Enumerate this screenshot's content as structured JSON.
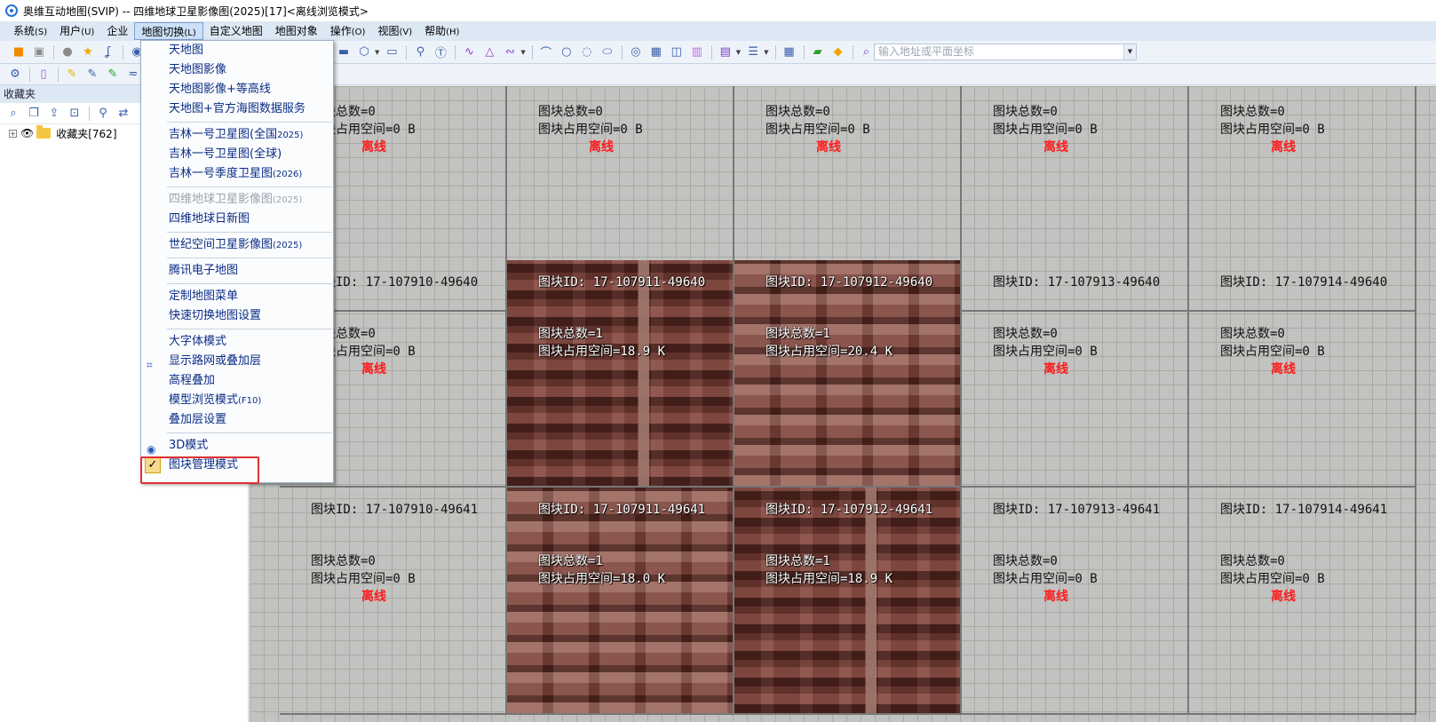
{
  "window": {
    "title": "奥维互动地图(SVIP) -- 四维地球卫星影像图(2025)[17]<离线浏览模式>"
  },
  "menubar": [
    {
      "label": "系统",
      "hotkey": "(S)"
    },
    {
      "label": "用户",
      "hotkey": "(U)"
    },
    {
      "label": "企业",
      "hotkey": ""
    },
    {
      "label": "地图切换",
      "hotkey": "(L)"
    },
    {
      "label": "自定义地图",
      "hotkey": ""
    },
    {
      "label": "地图对象",
      "hotkey": ""
    },
    {
      "label": "操作",
      "hotkey": "(O)"
    },
    {
      "label": "视图",
      "hotkey": "(V)"
    },
    {
      "label": "帮助",
      "hotkey": "(H)"
    }
  ],
  "toolbar": {
    "address_placeholder": "输入地址或平面坐标"
  },
  "panel": {
    "title": "收藏夹",
    "tree_root": "收藏夹[762]"
  },
  "map_menu": {
    "items": [
      {
        "label": "天地图"
      },
      {
        "label": "天地图影像"
      },
      {
        "label": "天地图影像+等高线"
      },
      {
        "label": "天地图+官方海图数据服务"
      },
      {
        "label": "吉林一号卫星图(全国",
        "small": "2025)"
      },
      {
        "label": "吉林一号卫星图(全球)"
      },
      {
        "label": "吉林一号季度卫星图",
        "small": "(2026)"
      },
      {
        "label": "四维地球卫星影像图",
        "small": "(2025)",
        "disabled": true
      },
      {
        "label": "四维地球日新图"
      },
      {
        "label": "世纪空间卫星影像图",
        "small": "(2025)"
      },
      {
        "label": "腾讯电子地图"
      },
      {
        "label": "定制地图菜单"
      },
      {
        "label": "快速切换地图设置"
      },
      {
        "label": "大字体模式"
      },
      {
        "label": "显示路网或叠加层"
      },
      {
        "label": "高程叠加"
      },
      {
        "label": "模型浏览模式",
        "small": "(F10)"
      },
      {
        "label": "叠加层设置"
      },
      {
        "label": "3D模式"
      },
      {
        "label": "图块管理模式",
        "checked": true
      }
    ]
  },
  "tiles": {
    "offline_label": "离线",
    "row0": [
      {
        "count": "图块总数=0",
        "space": "图块占用空间=0 B",
        "sat": false
      },
      {
        "count": "图块总数=0",
        "space": "图块占用空间=0 B",
        "sat": false
      },
      {
        "count": "图块总数=0",
        "space": "图块占用空间=0 B",
        "sat": false
      },
      {
        "count": "图块总数=0",
        "space": "图块占用空间=0 B",
        "sat": false
      },
      {
        "count": "图块总数=0",
        "space": "图块占用空间=0 B",
        "sat": false
      }
    ],
    "row1": [
      {
        "id": "图块ID: 17-107910-49640",
        "count": "图块总数=0",
        "space": "图块占用空间=0 B",
        "sat": false
      },
      {
        "id": "图块ID: 17-107911-49640",
        "count": "图块总数=1",
        "space": "图块占用空间=18.9 K",
        "sat": true
      },
      {
        "id": "图块ID: 17-107912-49640",
        "count": "图块总数=1",
        "space": "图块占用空间=20.4 K",
        "sat": true
      },
      {
        "id": "图块ID: 17-107913-49640",
        "count": "图块总数=0",
        "space": "图块占用空间=0 B",
        "sat": false
      },
      {
        "id": "图块ID: 17-107914-49640",
        "count": "图块总数=0",
        "space": "图块占用空间=0 B",
        "sat": false
      }
    ],
    "row2": [
      {
        "id": "图块ID: 17-107910-49641",
        "count": "图块总数=0",
        "space": "图块占用空间=0 B",
        "sat": false
      },
      {
        "id": "图块ID: 17-107911-49641",
        "count": "图块总数=1",
        "space": "图块占用空间=18.0 K",
        "sat": true
      },
      {
        "id": "图块ID: 17-107912-49641",
        "count": "图块总数=1",
        "space": "图块占用空间=18.9 K",
        "sat": true
      },
      {
        "id": "图块ID: 17-107913-49641",
        "count": "图块总数=0",
        "space": "图块占用空间=0 B",
        "sat": false
      },
      {
        "id": "图块ID: 17-107914-49641",
        "count": "图块总数=0",
        "space": "图块占用空间=0 B",
        "sat": false
      }
    ]
  }
}
